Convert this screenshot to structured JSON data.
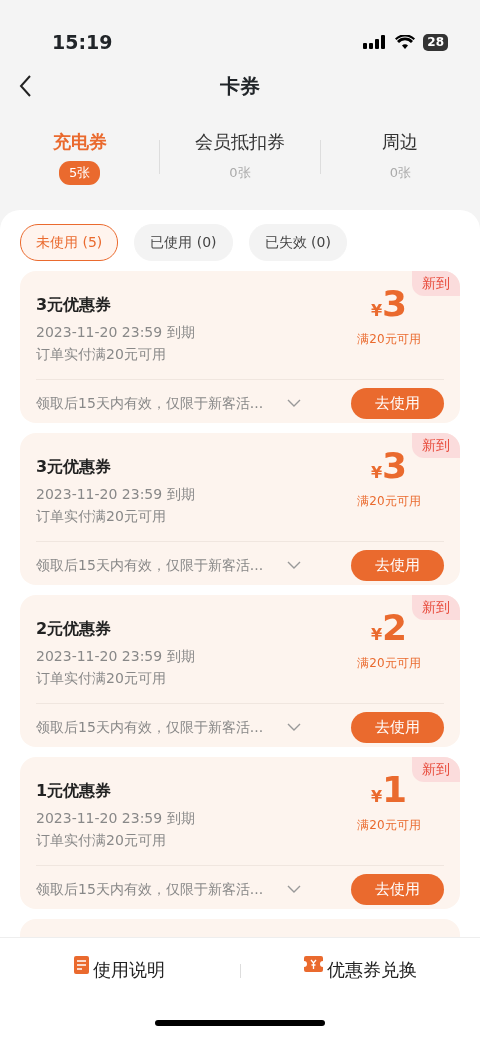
{
  "status_bar": {
    "time": "15:19",
    "battery": "28"
  },
  "header": {
    "title": "卡券"
  },
  "tabs": [
    {
      "label": "充电券",
      "count": "5张",
      "selected": true
    },
    {
      "label": "会员抵扣券",
      "count": "0张",
      "selected": false
    },
    {
      "label": "周边",
      "count": "0张",
      "selected": false
    }
  ],
  "filters": [
    {
      "label": "未使用 (5)",
      "selected": true
    },
    {
      "label": "已使用 (0)",
      "selected": false
    },
    {
      "label": "已失效 (0)",
      "selected": false
    }
  ],
  "coupons": [
    {
      "badge": "新到",
      "title": "3元优惠券",
      "expiry": "2023-11-20 23:59 到期",
      "condition": "订单实付满20元可用",
      "currency": "¥",
      "amount": "3",
      "threshold": "满20元可用",
      "note": "领取后15天内有效，仅限于新客活...",
      "button": "去使用"
    },
    {
      "badge": "新到",
      "title": "3元优惠券",
      "expiry": "2023-11-20 23:59 到期",
      "condition": "订单实付满20元可用",
      "currency": "¥",
      "amount": "3",
      "threshold": "满20元可用",
      "note": "领取后15天内有效，仅限于新客活...",
      "button": "去使用"
    },
    {
      "badge": "新到",
      "title": "2元优惠券",
      "expiry": "2023-11-20 23:59 到期",
      "condition": "订单实付满20元可用",
      "currency": "¥",
      "amount": "2",
      "threshold": "满20元可用",
      "note": "领取后15天内有效，仅限于新客活...",
      "button": "去使用"
    },
    {
      "badge": "新到",
      "title": "1元优惠券",
      "expiry": "2023-11-20 23:59 到期",
      "condition": "订单实付满20元可用",
      "currency": "¥",
      "amount": "1",
      "threshold": "满20元可用",
      "note": "领取后15天内有效，仅限于新客活...",
      "button": "去使用"
    }
  ],
  "footer": [
    {
      "kind": "guide",
      "label": "使用说明"
    },
    {
      "kind": "exchange",
      "label": "优惠券兑换"
    }
  ]
}
